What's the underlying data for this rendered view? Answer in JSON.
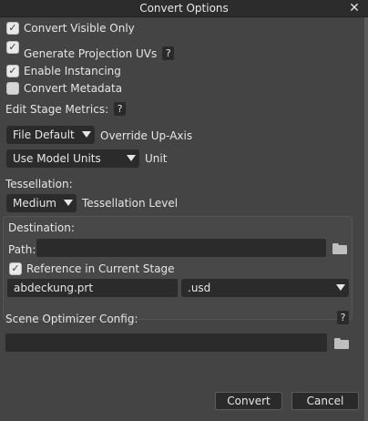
{
  "window": {
    "title": "Convert Options",
    "close_glyph": "✕"
  },
  "options": {
    "convert_visible_only": {
      "label": "Convert Visible Only",
      "checked": true
    },
    "generate_projection_uvs": {
      "label": "Generate Projection UVs",
      "checked": true
    },
    "enable_instancing": {
      "label": "Enable Instancing",
      "checked": true
    },
    "convert_metadata": {
      "label": "Convert Metadata",
      "checked": false
    }
  },
  "help_glyph": "?",
  "stage_metrics": {
    "heading": "Edit Stage Metrics:",
    "up_axis_value": "File Default",
    "up_axis_label": "Override Up-Axis",
    "unit_value": "Use Model Units",
    "unit_label": "Unit"
  },
  "tessellation": {
    "heading": "Tessellation:",
    "value": "Medium",
    "label": "Tessellation Level"
  },
  "destination": {
    "heading": "Destination:",
    "path_label": "Path:",
    "path_value": "",
    "reference_label": "Reference in Current Stage",
    "reference_checked": true,
    "filename": "abdeckung.prt",
    "extension": ".usd"
  },
  "scene_optimizer": {
    "heading": "Scene Optimizer Config:",
    "value": ""
  },
  "buttons": {
    "convert": "Convert",
    "cancel": "Cancel"
  },
  "colors": {
    "background": "#444444",
    "field": "#2b2b2b",
    "titlebar": "#2c2c2c"
  }
}
